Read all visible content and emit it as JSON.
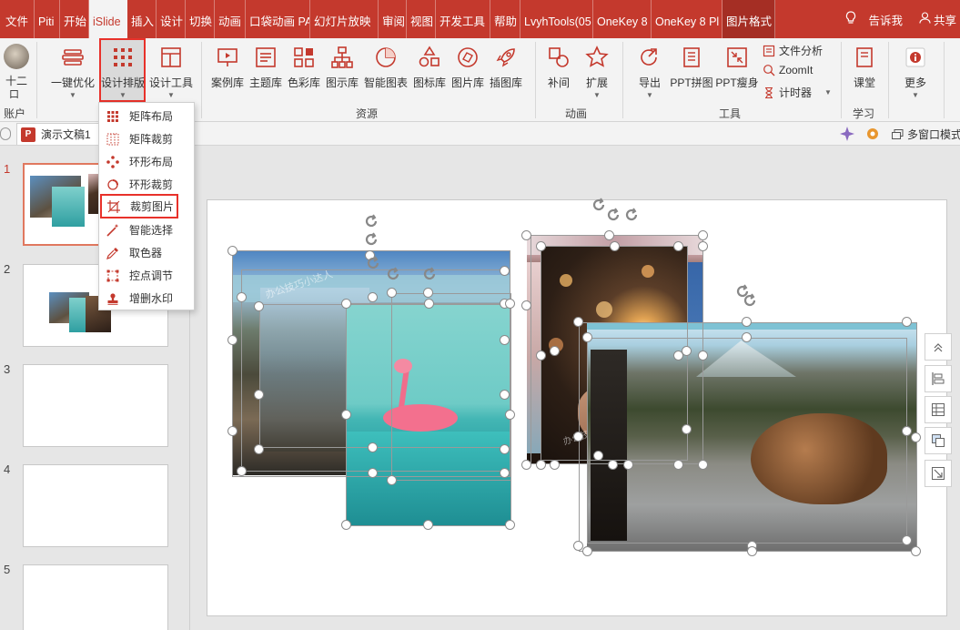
{
  "menubar": {
    "tabs": [
      "文件",
      "Piti",
      "开始",
      "iSlide",
      "插入",
      "设计",
      "切换",
      "动画",
      "口袋动画 PA",
      "幻灯片放映",
      "审阅",
      "视图",
      "开发工具",
      "帮助",
      "LvyhTools(05",
      "OneKey 8",
      "OneKey 8 Pl",
      "图片格式"
    ],
    "active_tab": "iSlide",
    "tell_me": "告诉我",
    "share": "共享"
  },
  "ribbon": {
    "account": {
      "name": "十二",
      "sub": "口",
      "label": "账户"
    },
    "one_click": "一键优化",
    "design_layout": "设计排版",
    "design_tools": "设计工具",
    "resources": [
      "案例库",
      "主题库",
      "色彩库",
      "图示库",
      "智能图表",
      "图标库",
      "图片库",
      "插图库"
    ],
    "resources_label": "资源",
    "anim": [
      "补间",
      "扩展"
    ],
    "anim_label": "动画",
    "tools": [
      "导出",
      "PPT拼图",
      "PPT瘦身"
    ],
    "tools_small": [
      "文件分析",
      "ZoomIt",
      "计时器"
    ],
    "tools_label": "工具",
    "learn": "课堂",
    "learn_label": "学习",
    "more": "更多"
  },
  "docbar": {
    "doc_name": "演示文稿1",
    "multi_window": "多窗口模式"
  },
  "dropdown": {
    "items": [
      "矩阵布局",
      "矩阵裁剪",
      "环形布局",
      "环形裁剪",
      "裁剪图片",
      "智能选择",
      "取色器",
      "控点调节",
      "增删水印"
    ],
    "highlighted": "裁剪图片"
  },
  "slides": {
    "numbers": [
      "1",
      "2",
      "3",
      "4",
      "5"
    ]
  },
  "canvas": {
    "watermark_1": "办公技巧小达人",
    "watermark_2": "办公技巧小达人"
  },
  "colors": {
    "accent": "#c4392d",
    "highlight": "#e8312a"
  }
}
